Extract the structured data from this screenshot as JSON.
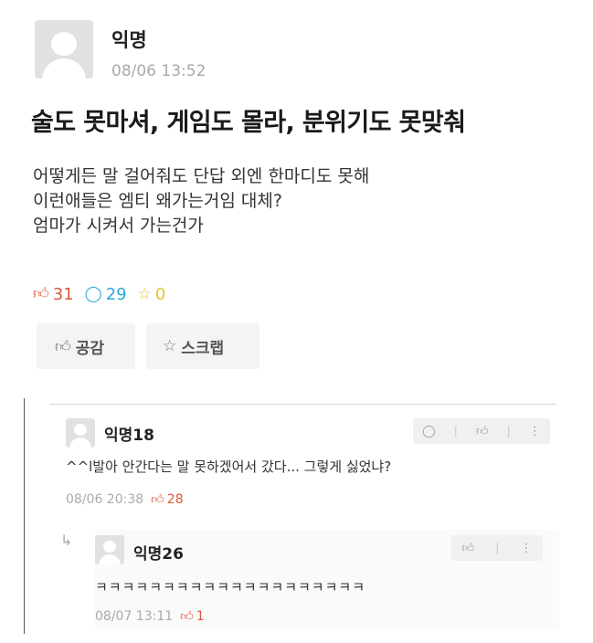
{
  "post": {
    "author": "익명",
    "time": "08/06 13:52",
    "title": "술도 못마셔, 게임도 몰라, 분위기도 못맞춰",
    "body": [
      "어떻게든 말 걸어줘도 단답 외엔 한마디도 못해",
      "이런애들은 엠티 왜가는거임 대체?",
      "엄마가 시켜서 가는건가"
    ],
    "stats": {
      "likes": "31",
      "comments": "29",
      "scraps": "0"
    },
    "actions": {
      "like_label": "공감",
      "scrap_label": "스크랩"
    }
  },
  "comments": [
    {
      "author": "익명18",
      "text": "^^l발아 안간다는 말 못하겠어서 갔다... 그렇게 싫었냐?",
      "time": "08/06 20:38",
      "likes": "28"
    },
    {
      "author": "익명26",
      "text": "ㅋㅋㅋㅋㅋㅋㅋㅋㅋㅋㅋㅋㅋㅋㅋㅋㅋㅋㅋㅋ",
      "time": "08/07 13:11",
      "likes": "1"
    }
  ],
  "icons": {
    "thumb": "👍︎",
    "comment": "◯",
    "star": "☆",
    "kebab": "⋮",
    "reply": "↳"
  },
  "colors": {
    "like": "#e0573b",
    "comment": "#29a9d6",
    "scrap": "#e8c32d",
    "muted": "#a9a9a9"
  }
}
